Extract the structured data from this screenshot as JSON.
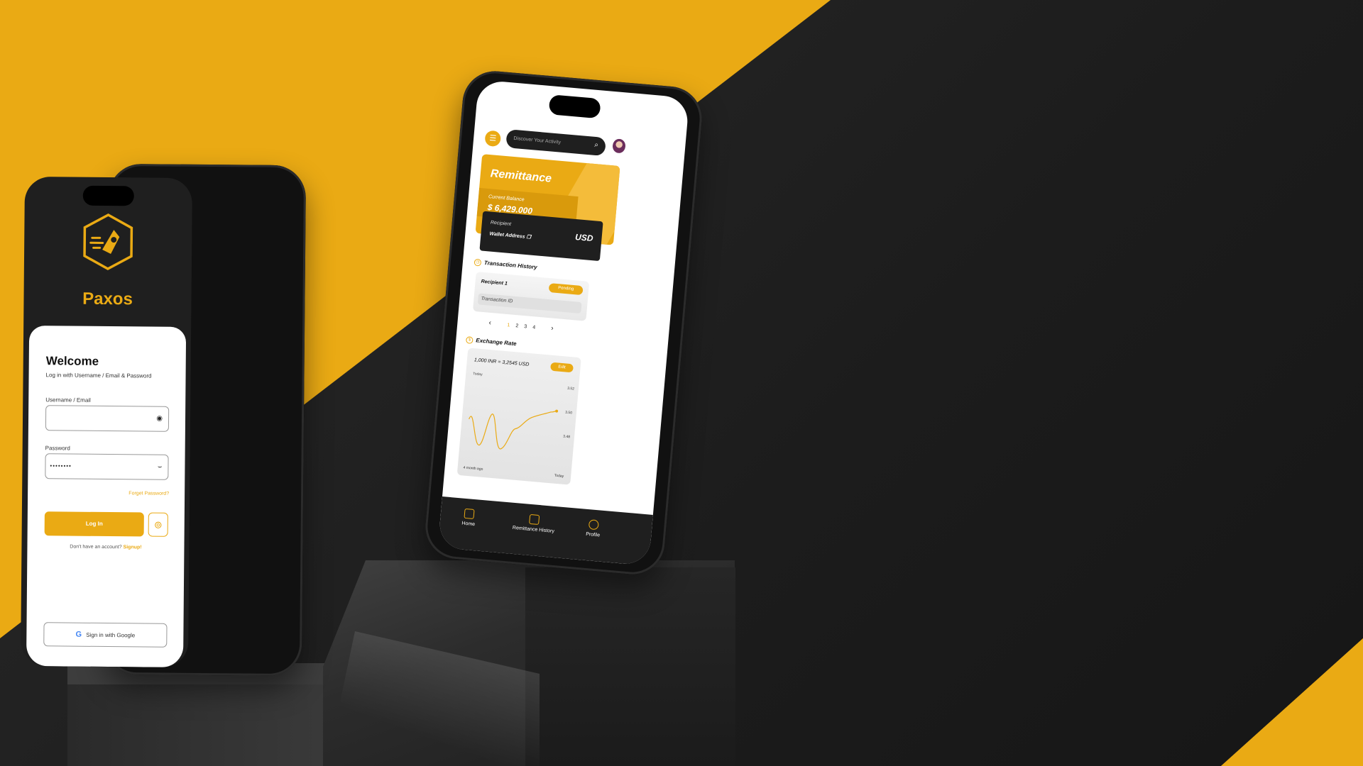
{
  "colors": {
    "accent": "#EAAA14",
    "dark": "#1f1f1f",
    "background_dark": "#1c1c1c"
  },
  "login": {
    "brand": "Paxos",
    "logo_icon": "paxos-rocket-hexagon-icon",
    "title": "Welcome",
    "subtitle": "Log in with Username / Email & Password",
    "username_label": "Username / Email",
    "username_value": "",
    "username_icon": "eye-icon",
    "password_label": "Password",
    "password_value": "••••••••",
    "password_icon": "eye-closed-icon",
    "forgot_label": "Forget Password?",
    "login_button": "Log In",
    "fingerprint_icon": "fingerprint-icon",
    "no_account_text": "Don't have an account?",
    "signup_link": "Signup!",
    "google_button": "Sign in with Google"
  },
  "dashboard": {
    "menu_icon": "menu-icon",
    "search_placeholder": "Discover Your Activity",
    "search_icon": "search-icon",
    "remittance_title": "Remittance",
    "balance_label": "Current Balance",
    "balance_value": "$ 6,429.000",
    "recipient_label": "Recipient",
    "wallet_address_label": "Wallet Address",
    "copy_icon": "copy-icon",
    "currency": "USD",
    "transaction_history_title": "Transaction History",
    "transaction": {
      "recipient": "Recipient 1",
      "status": "Pending",
      "id_label": "Transaction ID"
    },
    "pagination": [
      "1",
      "2",
      "3",
      "4"
    ],
    "current_page": "1",
    "exchange_rate_title": "Exchange Rate",
    "exchange": {
      "rate_text": "1,000 INR = 3,2545 USD",
      "period": "Today",
      "edit_label": "Edit",
      "y_ticks": [
        "3.52",
        "3.50",
        "3.48"
      ],
      "x_start": "4 month ago",
      "x_end": "Today"
    },
    "tabs": [
      {
        "label": "Home",
        "icon": "home-icon"
      },
      {
        "label": "Remittance History",
        "icon": "remittance-history-icon"
      },
      {
        "label": "Profile",
        "icon": "profile-icon"
      }
    ]
  }
}
